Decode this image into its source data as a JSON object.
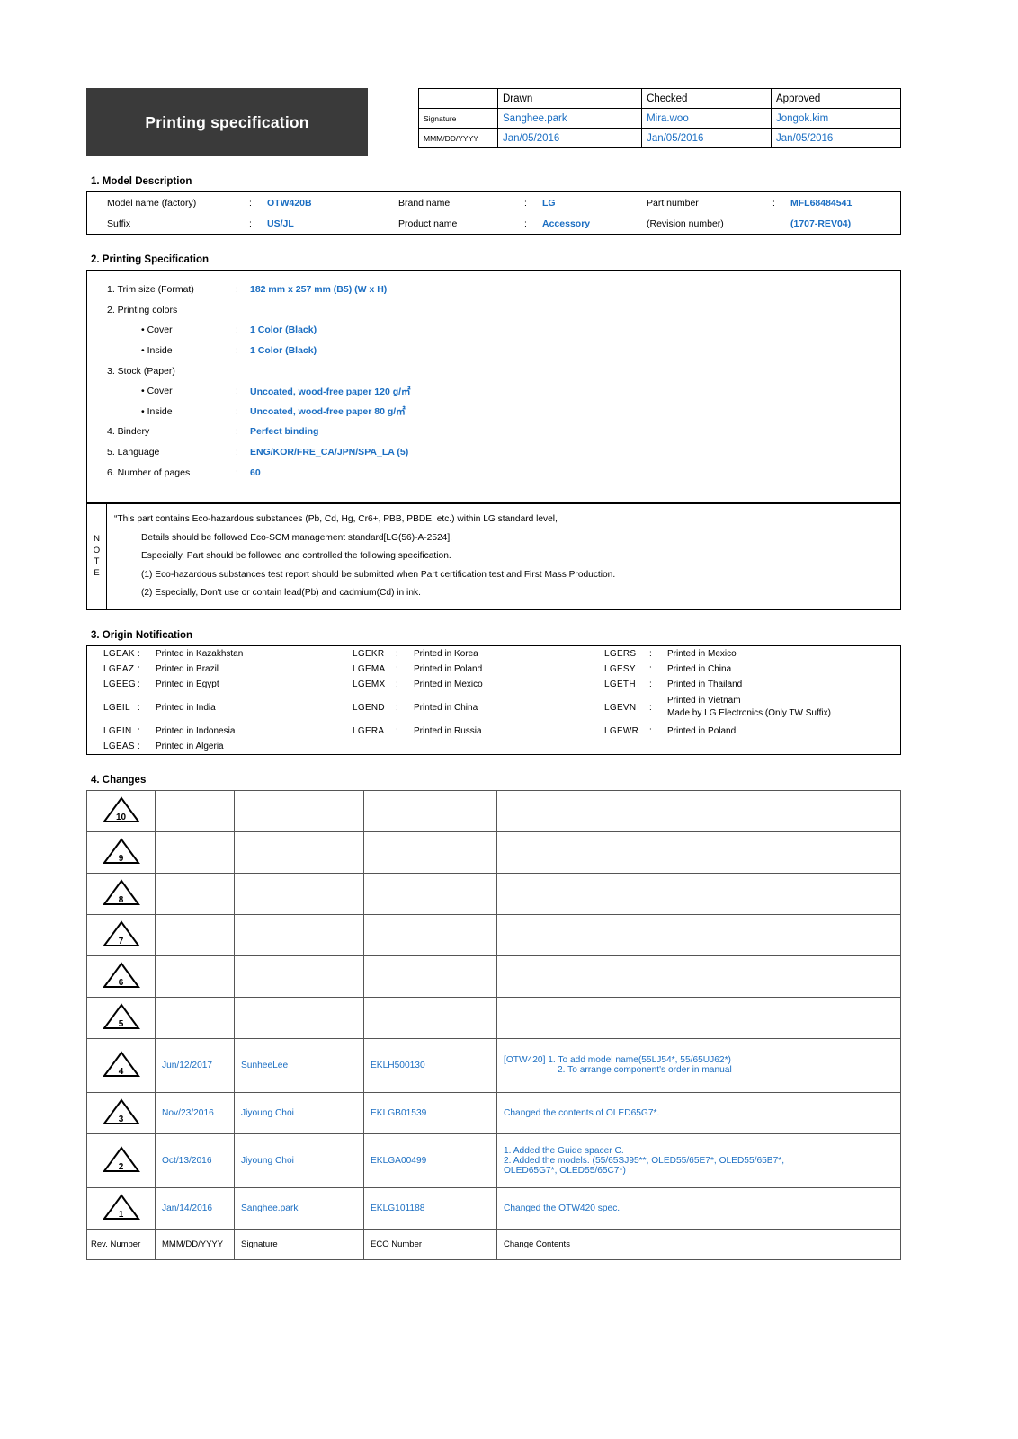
{
  "header": {
    "title": "Printing specification",
    "approval": {
      "columns": [
        "Drawn",
        "Checked",
        "Approved"
      ],
      "row_labels": [
        "Signature",
        "MMM/DD/YYYY"
      ],
      "signatures": [
        "Sanghee.park",
        "Mira.woo",
        "Jongok.kim"
      ],
      "dates": [
        "Jan/05/2016",
        "Jan/05/2016",
        "Jan/05/2016"
      ]
    }
  },
  "sections": {
    "model": "1. Model Description",
    "printing": "2. Printing Specification",
    "origin": "3. Origin Notification",
    "changes": "4. Changes"
  },
  "model": {
    "model_name_label": "Model name (factory)",
    "model_name_value": "OTW420B",
    "brand_label": "Brand name",
    "brand_value": "LG",
    "part_label": "Part number",
    "part_value": "MFL68484541",
    "suffix_label": "Suffix",
    "suffix_value": "US/JL",
    "product_label": "Product name",
    "product_value": "Accessory",
    "revision_label": "(Revision number)",
    "revision_value": "(1707-REV04)",
    "colon": ":"
  },
  "printing": {
    "rows": [
      {
        "label": "1. Trim size (Format)",
        "colon": ":",
        "value": "182 mm x 257 mm (B5) (W x H)",
        "indent": false
      },
      {
        "label": "2. Printing colors",
        "colon": "",
        "value": "",
        "indent": false
      },
      {
        "label": "• Cover",
        "colon": ":",
        "value": "1 Color (Black)",
        "indent": true
      },
      {
        "label": "• Inside",
        "colon": ":",
        "value": "1 Color (Black)",
        "indent": true
      },
      {
        "label": "3. Stock (Paper)",
        "colon": "",
        "value": "",
        "indent": false
      },
      {
        "label": "• Cover",
        "colon": ":",
        "value": "Uncoated, wood-free paper 120 g/㎡",
        "indent": true
      },
      {
        "label": "• Inside",
        "colon": ":",
        "value": "Uncoated, wood-free paper 80 g/㎡",
        "indent": true
      },
      {
        "label": "4. Bindery",
        "colon": ":",
        "value": "Perfect binding",
        "indent": false
      },
      {
        "label": "5. Language",
        "colon": ":",
        "value": "ENG/KOR/FRE_CA/JPN/SPA_LA (5)",
        "indent": false
      },
      {
        "label": "6. Number of pages",
        "colon": ":",
        "value": "60",
        "indent": false
      }
    ]
  },
  "note": {
    "label_letters": [
      "N",
      "O",
      "T",
      "E"
    ],
    "lines": [
      {
        "text": "“This part contains Eco-hazardous substances (Pb, Cd, Hg, Cr6+, PBB, PBDE, etc.) within LG standard level,",
        "indent": false
      },
      {
        "text": "Details should be followed Eco-SCM management standard[LG(56)-A-2524].",
        "indent": true
      },
      {
        "text": "Especially, Part should be followed and controlled the following specification.",
        "indent": true
      },
      {
        "text": "(1) Eco-hazardous substances test report should be submitted when Part certification test and First Mass Production.",
        "indent": true
      },
      {
        "text": "(2) Especially, Don't use or contain lead(Pb) and cadmium(Cd) in ink.",
        "indent": true
      }
    ]
  },
  "origin": {
    "colon": ":",
    "rows": [
      {
        "c1": "LGEAK",
        "t1": "Printed in Kazakhstan",
        "c2": "LGEKR",
        "t2": "Printed in Korea",
        "c3": "LGERS",
        "t3": "Printed in Mexico",
        "t3b": ""
      },
      {
        "c1": "LGEAZ",
        "t1": "Printed in Brazil",
        "c2": "LGEMA",
        "t2": "Printed in Poland",
        "c3": "LGESY",
        "t3": "Printed in China",
        "t3b": ""
      },
      {
        "c1": "LGEEG",
        "t1": "Printed in Egypt",
        "c2": "LGEMX",
        "t2": "Printed in Mexico",
        "c3": "LGETH",
        "t3": "Printed in Thailand",
        "t3b": ""
      },
      {
        "c1": "LGEIL",
        "t1": "Printed in India",
        "c2": "LGEND",
        "t2": "Printed in China",
        "c3": "LGEVN",
        "t3": "Printed in Vietnam",
        "t3b": "Made by LG Electronics (Only TW Suffix)"
      },
      {
        "c1": "LGEIN",
        "t1": "Printed in Indonesia",
        "c2": "LGERA",
        "t2": "Printed in Russia",
        "c3": "LGEWR",
        "t3": "Printed in Poland",
        "t3b": ""
      },
      {
        "c1": "LGEAS",
        "t1": "Printed in Algeria",
        "c2": "",
        "t2": "",
        "c3": "",
        "t3": "",
        "t3b": ""
      }
    ]
  },
  "changes": {
    "rows": [
      {
        "rev": "10",
        "date": "",
        "sig": "",
        "eco": "",
        "content": "",
        "content2": "",
        "content3": ""
      },
      {
        "rev": "9",
        "date": "",
        "sig": "",
        "eco": "",
        "content": "",
        "content2": "",
        "content3": ""
      },
      {
        "rev": "8",
        "date": "",
        "sig": "",
        "eco": "",
        "content": "",
        "content2": "",
        "content3": ""
      },
      {
        "rev": "7",
        "date": "",
        "sig": "",
        "eco": "",
        "content": "",
        "content2": "",
        "content3": ""
      },
      {
        "rev": "6",
        "date": "",
        "sig": "",
        "eco": "",
        "content": "",
        "content2": "",
        "content3": ""
      },
      {
        "rev": "5",
        "date": "",
        "sig": "",
        "eco": "",
        "content": "",
        "content2": "",
        "content3": ""
      },
      {
        "rev": "4",
        "date": "Jun/12/2017",
        "sig": "SunheeLee",
        "eco": "EKLH500130",
        "content": "[OTW420] 1. To add model name(55LJ54*, 55/65UJ62*)",
        "content2": "2. To arrange component's order in manual",
        "content3": ""
      },
      {
        "rev": "3",
        "date": "Nov/23/2016",
        "sig": "Jiyoung Choi",
        "eco": "EKLGB01539",
        "content": "Changed the contents of OLED65G7*.",
        "content2": "",
        "content3": ""
      },
      {
        "rev": "2",
        "date": "Oct/13/2016",
        "sig": "Jiyoung Choi",
        "eco": "EKLGA00499",
        "content": "1. Added the Guide spacer C.",
        "content2": "2. Added the models. (55/65SJ95**, OLED55/65E7*,  OLED55/65B7*,",
        "content3": "OLED65G7*, OLED55/65C7*)"
      },
      {
        "rev": "1",
        "date": "Jan/14/2016",
        "sig": "Sanghee.park",
        "eco": "EKLG101188",
        "content": "Changed the OTW420 spec.",
        "content2": "",
        "content3": ""
      }
    ],
    "footer": {
      "rev": "Rev. Number",
      "date": "MMM/DD/YYYY",
      "sig": "Signature",
      "eco": "ECO Number",
      "content": "Change Contents"
    }
  },
  "colors": {
    "accent_blue": "#1b6ec2",
    "title_bg": "#3a3a3a",
    "border": "#000000"
  }
}
